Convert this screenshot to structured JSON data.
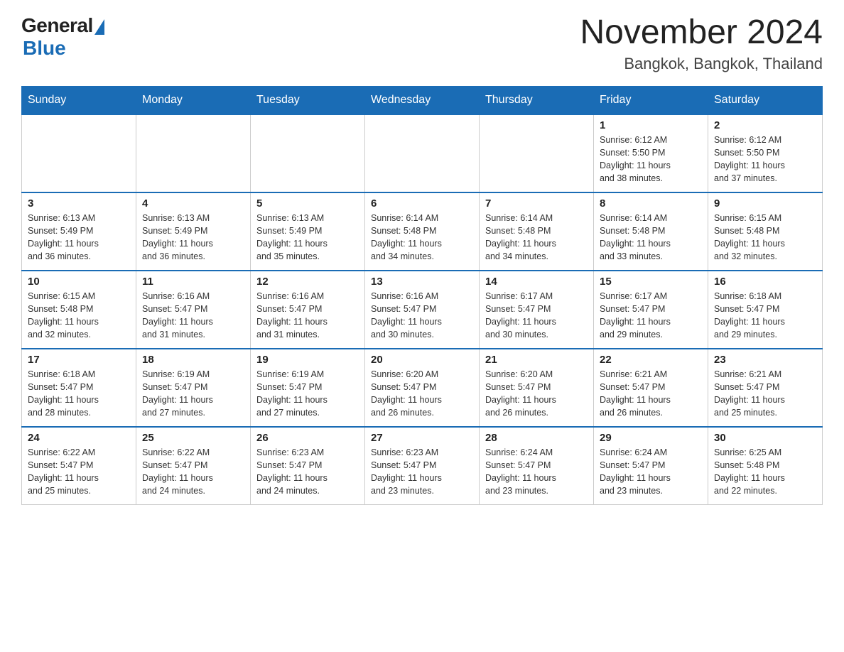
{
  "header": {
    "logo": {
      "general": "General",
      "blue": "Blue"
    },
    "title": "November 2024",
    "location": "Bangkok, Bangkok, Thailand"
  },
  "calendar": {
    "weekdays": [
      "Sunday",
      "Monday",
      "Tuesday",
      "Wednesday",
      "Thursday",
      "Friday",
      "Saturday"
    ],
    "weeks": [
      {
        "days": [
          {
            "num": "",
            "info": "",
            "empty": true
          },
          {
            "num": "",
            "info": "",
            "empty": true
          },
          {
            "num": "",
            "info": "",
            "empty": true
          },
          {
            "num": "",
            "info": "",
            "empty": true
          },
          {
            "num": "",
            "info": "",
            "empty": true
          },
          {
            "num": "1",
            "info": "Sunrise: 6:12 AM\nSunset: 5:50 PM\nDaylight: 11 hours\nand 38 minutes."
          },
          {
            "num": "2",
            "info": "Sunrise: 6:12 AM\nSunset: 5:50 PM\nDaylight: 11 hours\nand 37 minutes."
          }
        ]
      },
      {
        "days": [
          {
            "num": "3",
            "info": "Sunrise: 6:13 AM\nSunset: 5:49 PM\nDaylight: 11 hours\nand 36 minutes."
          },
          {
            "num": "4",
            "info": "Sunrise: 6:13 AM\nSunset: 5:49 PM\nDaylight: 11 hours\nand 36 minutes."
          },
          {
            "num": "5",
            "info": "Sunrise: 6:13 AM\nSunset: 5:49 PM\nDaylight: 11 hours\nand 35 minutes."
          },
          {
            "num": "6",
            "info": "Sunrise: 6:14 AM\nSunset: 5:48 PM\nDaylight: 11 hours\nand 34 minutes."
          },
          {
            "num": "7",
            "info": "Sunrise: 6:14 AM\nSunset: 5:48 PM\nDaylight: 11 hours\nand 34 minutes."
          },
          {
            "num": "8",
            "info": "Sunrise: 6:14 AM\nSunset: 5:48 PM\nDaylight: 11 hours\nand 33 minutes."
          },
          {
            "num": "9",
            "info": "Sunrise: 6:15 AM\nSunset: 5:48 PM\nDaylight: 11 hours\nand 32 minutes."
          }
        ]
      },
      {
        "days": [
          {
            "num": "10",
            "info": "Sunrise: 6:15 AM\nSunset: 5:48 PM\nDaylight: 11 hours\nand 32 minutes."
          },
          {
            "num": "11",
            "info": "Sunrise: 6:16 AM\nSunset: 5:47 PM\nDaylight: 11 hours\nand 31 minutes."
          },
          {
            "num": "12",
            "info": "Sunrise: 6:16 AM\nSunset: 5:47 PM\nDaylight: 11 hours\nand 31 minutes."
          },
          {
            "num": "13",
            "info": "Sunrise: 6:16 AM\nSunset: 5:47 PM\nDaylight: 11 hours\nand 30 minutes."
          },
          {
            "num": "14",
            "info": "Sunrise: 6:17 AM\nSunset: 5:47 PM\nDaylight: 11 hours\nand 30 minutes."
          },
          {
            "num": "15",
            "info": "Sunrise: 6:17 AM\nSunset: 5:47 PM\nDaylight: 11 hours\nand 29 minutes."
          },
          {
            "num": "16",
            "info": "Sunrise: 6:18 AM\nSunset: 5:47 PM\nDaylight: 11 hours\nand 29 minutes."
          }
        ]
      },
      {
        "days": [
          {
            "num": "17",
            "info": "Sunrise: 6:18 AM\nSunset: 5:47 PM\nDaylight: 11 hours\nand 28 minutes."
          },
          {
            "num": "18",
            "info": "Sunrise: 6:19 AM\nSunset: 5:47 PM\nDaylight: 11 hours\nand 27 minutes."
          },
          {
            "num": "19",
            "info": "Sunrise: 6:19 AM\nSunset: 5:47 PM\nDaylight: 11 hours\nand 27 minutes."
          },
          {
            "num": "20",
            "info": "Sunrise: 6:20 AM\nSunset: 5:47 PM\nDaylight: 11 hours\nand 26 minutes."
          },
          {
            "num": "21",
            "info": "Sunrise: 6:20 AM\nSunset: 5:47 PM\nDaylight: 11 hours\nand 26 minutes."
          },
          {
            "num": "22",
            "info": "Sunrise: 6:21 AM\nSunset: 5:47 PM\nDaylight: 11 hours\nand 26 minutes."
          },
          {
            "num": "23",
            "info": "Sunrise: 6:21 AM\nSunset: 5:47 PM\nDaylight: 11 hours\nand 25 minutes."
          }
        ]
      },
      {
        "days": [
          {
            "num": "24",
            "info": "Sunrise: 6:22 AM\nSunset: 5:47 PM\nDaylight: 11 hours\nand 25 minutes."
          },
          {
            "num": "25",
            "info": "Sunrise: 6:22 AM\nSunset: 5:47 PM\nDaylight: 11 hours\nand 24 minutes."
          },
          {
            "num": "26",
            "info": "Sunrise: 6:23 AM\nSunset: 5:47 PM\nDaylight: 11 hours\nand 24 minutes."
          },
          {
            "num": "27",
            "info": "Sunrise: 6:23 AM\nSunset: 5:47 PM\nDaylight: 11 hours\nand 23 minutes."
          },
          {
            "num": "28",
            "info": "Sunrise: 6:24 AM\nSunset: 5:47 PM\nDaylight: 11 hours\nand 23 minutes."
          },
          {
            "num": "29",
            "info": "Sunrise: 6:24 AM\nSunset: 5:47 PM\nDaylight: 11 hours\nand 23 minutes."
          },
          {
            "num": "30",
            "info": "Sunrise: 6:25 AM\nSunset: 5:48 PM\nDaylight: 11 hours\nand 22 minutes."
          }
        ]
      }
    ]
  }
}
